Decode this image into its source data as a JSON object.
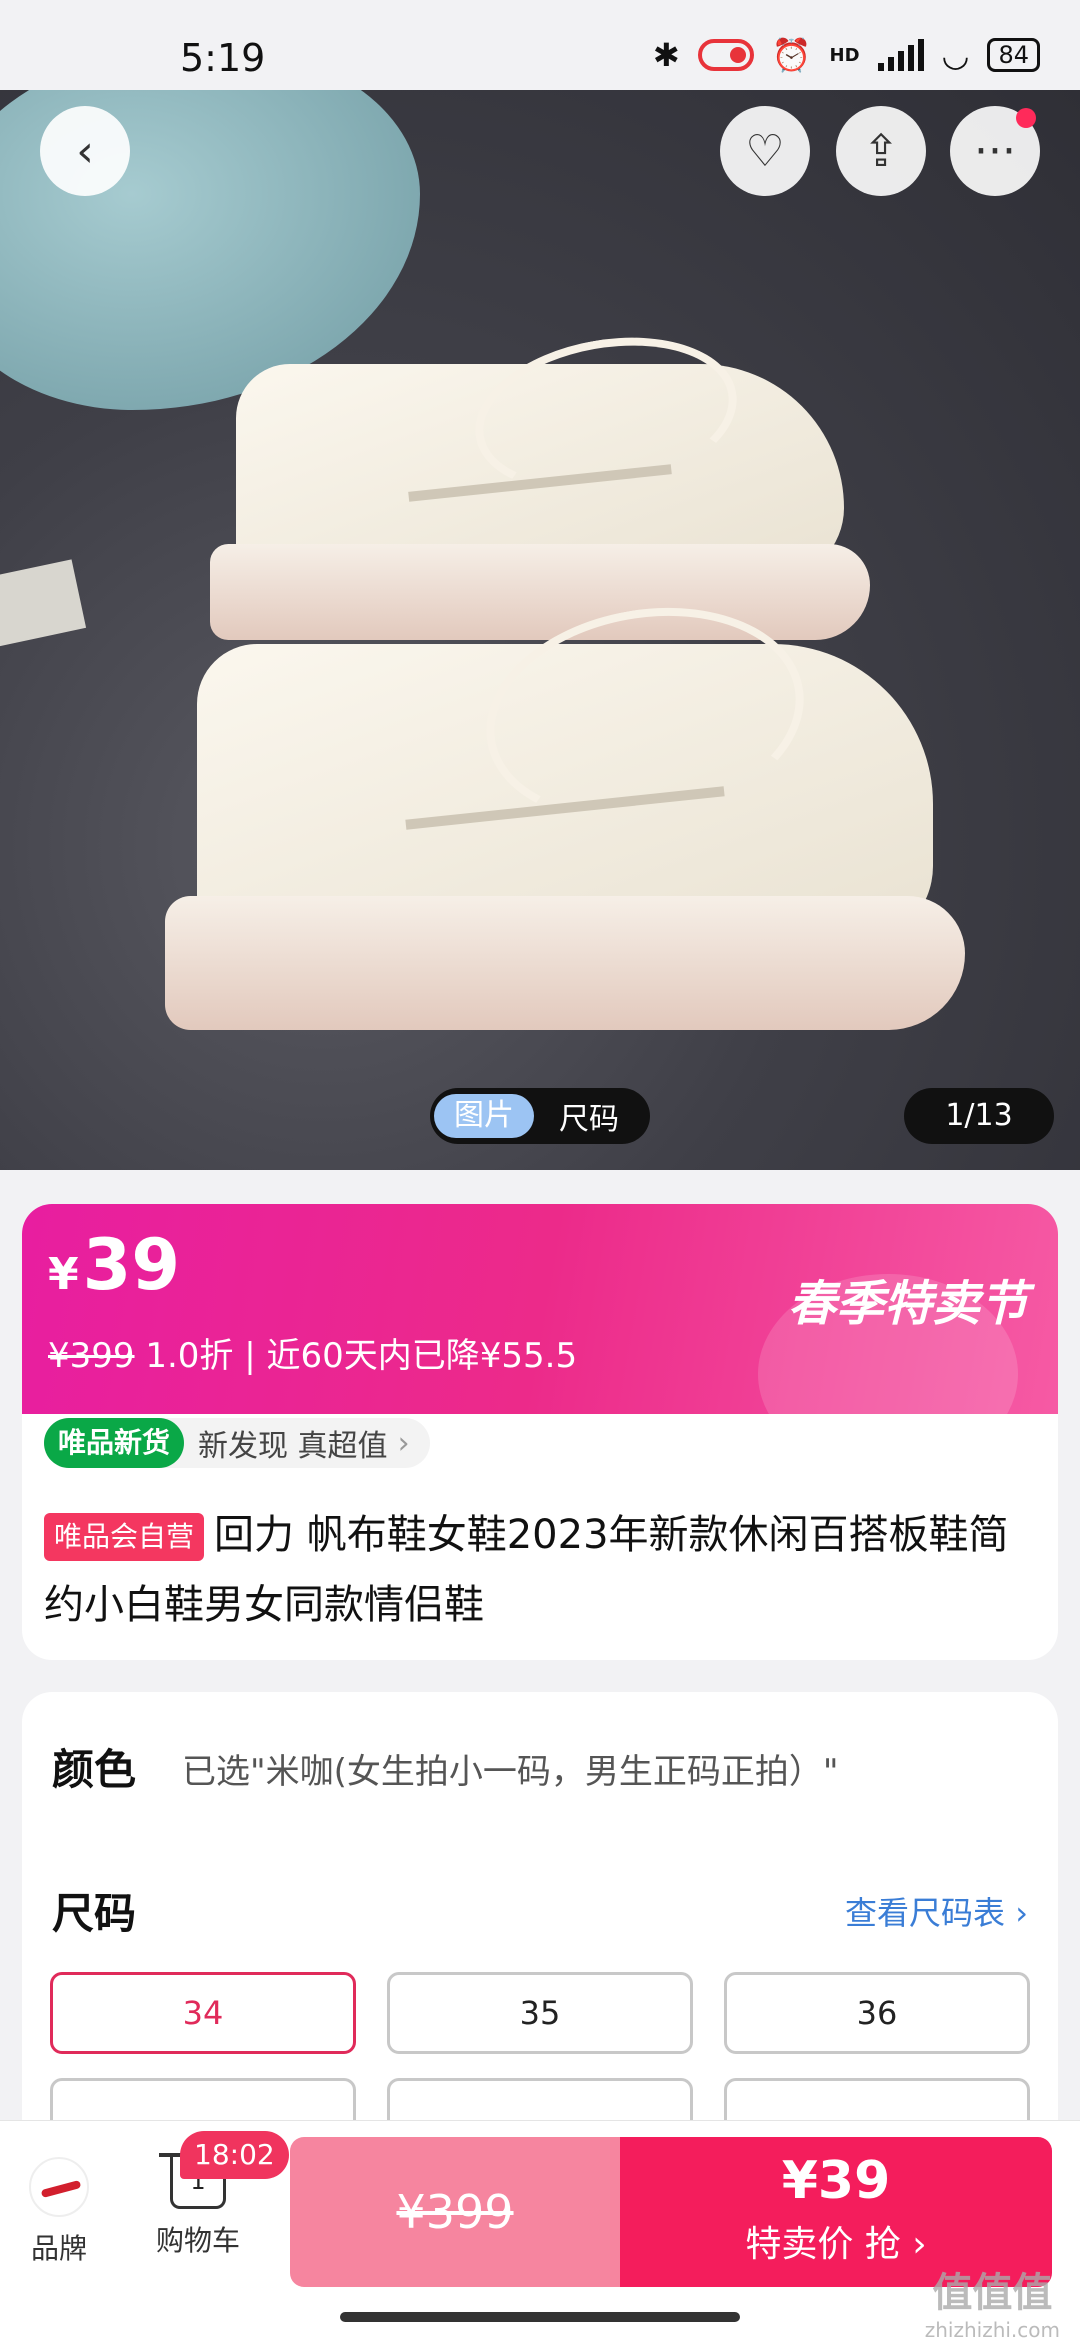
{
  "status": {
    "time": "5:19",
    "hd": "HD",
    "battery": "84"
  },
  "gallery": {
    "tabs": [
      "图片",
      "尺码"
    ],
    "counter": "1/13"
  },
  "price": {
    "currency": "¥",
    "current": "39",
    "original": "¥399",
    "discount": "1.0折",
    "drop": "| 近60天内已降¥55.5",
    "festival": "春季特卖节"
  },
  "tag": {
    "badge": "唯品新货",
    "text": "新发现 真超值",
    "chevron": "›"
  },
  "product": {
    "self_tag": "唯品会自营",
    "title": "回力 帆布鞋女鞋2023年新款休闲百搭板鞋简约小白鞋男女同款情侣鞋"
  },
  "spec": {
    "color_label": "颜色",
    "color_value": "已选\"米咖(女生拍小一码，男生正码正拍）\"",
    "size_label": "尺码",
    "size_chart_link": "查看尺码表 ›",
    "sizes": [
      "34",
      "35",
      "36"
    ],
    "selected_size": "34"
  },
  "bottom": {
    "brand_label": "品牌",
    "cart_label": "购物车",
    "cart_count": "1",
    "timer": "18:02",
    "original_price": "¥399",
    "sale_price": "¥39",
    "sale_label": "特卖价 抢 ›"
  },
  "watermark": {
    "text": "值值值",
    "url": "zhizhizhi.com"
  },
  "colors": {
    "accent": "#f41d5c",
    "band": "#e81ea0",
    "green": "#0aa847",
    "link": "#3a7dd6"
  }
}
